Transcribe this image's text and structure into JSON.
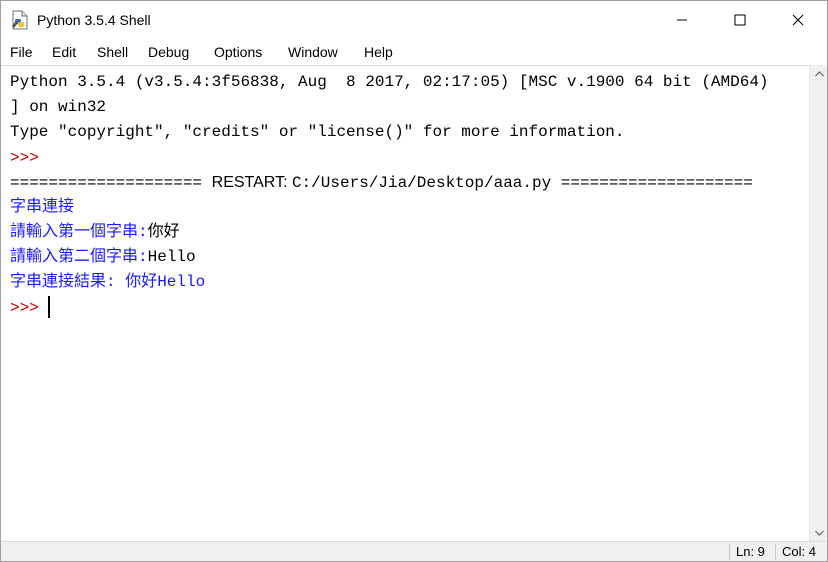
{
  "window": {
    "title": "Python 3.5.4 Shell",
    "icon": "python-file-icon",
    "controls": [
      "minimize-icon",
      "maximize-icon",
      "close-icon"
    ]
  },
  "menu": {
    "items": [
      "File",
      "Edit",
      "Shell",
      "Debug",
      "Options",
      "Window",
      "Help"
    ]
  },
  "shell": {
    "banner_line1": "Python 3.5.4 (v3.5.4:3f56838, Aug  8 2017, 02:17:05) [MSC v.1900 64 bit (AMD64)",
    "banner_line2": "] on win32",
    "banner_line3": "Type \"copyright\", \"credits\" or \"license()\" for more information.",
    "prompt1": ">>> ",
    "restart_prefix": "==================== ",
    "restart_word": "RESTART: ",
    "restart_path": "C:/Users/Jia/Desktop/aaa.py",
    "restart_suffix": " ====================",
    "output1": "字串連接",
    "input1_prompt": "請輸入第一個字串:",
    "input1_value": "你好",
    "input2_prompt": "請輸入第二個字串:",
    "input2_value": "Hello",
    "result": "字串連接結果: 你好Hello",
    "prompt2": ">>> "
  },
  "colors": {
    "output": "#1a1aff",
    "prompt": "#c00000",
    "stdin": "#000000"
  },
  "status": {
    "line": "Ln: 9",
    "col": "Col: 4"
  }
}
